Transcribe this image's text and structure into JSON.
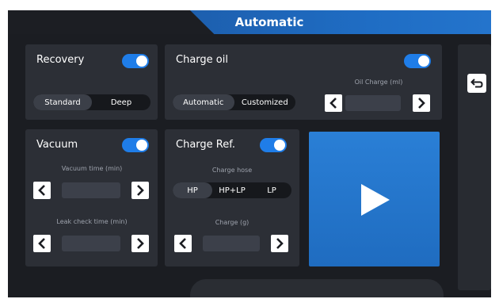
{
  "header": {
    "title": "Automatic"
  },
  "recovery": {
    "title": "Recovery",
    "enabled": true,
    "modes": [
      "Standard",
      "Deep"
    ],
    "selected_mode": "Standard"
  },
  "charge_oil": {
    "title": "Charge oil",
    "enabled": true,
    "modes": [
      "Automatic",
      "Customized"
    ],
    "selected_mode": "Automatic",
    "field_label": "Oil Charge (ml)",
    "value": ""
  },
  "vacuum": {
    "title": "Vacuum",
    "enabled": true,
    "vacuum_time_label": "Vacuum time (min)",
    "vacuum_time_value": "",
    "leak_check_label": "Leak check time (min)",
    "leak_check_value": ""
  },
  "charge_ref": {
    "title": "Charge Ref.",
    "enabled": true,
    "hose_label": "Charge hose",
    "hose_options": [
      "HP",
      "HP+LP",
      "LP"
    ],
    "selected_hose": "HP",
    "charge_label": "Charge (g)",
    "charge_value": ""
  },
  "icons": {
    "start": "play-icon",
    "back": "back-arrow-icon",
    "prev": "chevron-left-icon",
    "next": "chevron-right-icon"
  },
  "colors": {
    "accent": "#1f7de8",
    "background": "#1b1d22",
    "panel": "#2c2f36"
  }
}
